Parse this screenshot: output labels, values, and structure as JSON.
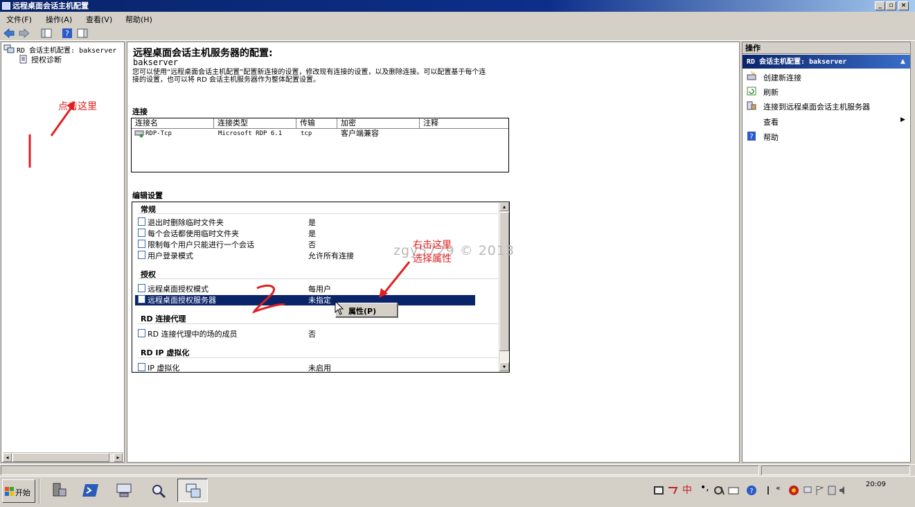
{
  "window": {
    "title": "远程桌面会话主机配置"
  },
  "menu": [
    "文件(F)",
    "操作(A)",
    "查看(V)",
    "帮助(H)"
  ],
  "tree": {
    "root": "RD 会话主机配置: bakserver",
    "child": "授权诊断"
  },
  "main": {
    "heading": "远程桌面会话主机服务器的配置:",
    "server": "bakserver",
    "description1": "您可以使用“远程桌面会话主机配置”配置新连接的设置，修改现有连接的设置，以及删除连接。可以配置基于每个连",
    "description2": "接的设置，也可以将 RD 会话主机服务器作为整体配置设置。",
    "connections_title": "连接",
    "columns": [
      "连接名",
      "连接类型",
      "传输",
      "加密",
      "注释"
    ],
    "connection": {
      "name": "RDP-Tcp",
      "type": "Microsoft RDP 6.1",
      "transport": "tcp",
      "encryption": "客户端兼容",
      "comment": ""
    },
    "edit_title": "编辑设置",
    "sections": {
      "general": "常规",
      "licensing": "授权",
      "broker": "RD 连接代理",
      "ipv": "RD IP 虚拟化"
    },
    "settings": {
      "s1": {
        "label": "退出时删除临时文件夹",
        "value": "是"
      },
      "s2": {
        "label": "每个会话都使用临时文件夹",
        "value": "是"
      },
      "s3": {
        "label": "限制每个用户只能进行一个会话",
        "value": "否"
      },
      "s4": {
        "label": "用户登录模式",
        "value": "允许所有连接"
      },
      "s5": {
        "label": "远程桌面授权模式",
        "value": "每用户"
      },
      "s6": {
        "label": "远程桌面授权服务器",
        "value": "未指定"
      },
      "s7": {
        "label": "RD 连接代理中的场的成员",
        "value": "否"
      },
      "s8": {
        "label": "IP 虚拟化",
        "value": "未启用"
      }
    },
    "context_menu": "属性(P)"
  },
  "actions": {
    "pane_title": "操作",
    "section": "RD 会话主机配置: bakserver",
    "items": [
      "创建新连接",
      "刷新",
      "连接到远程桌面会话主机服务器",
      "查看",
      "帮助"
    ]
  },
  "annotations": {
    "click_here": "点击这里",
    "right_click": "右击这里",
    "choose_props": "选择属性",
    "watermark": "zgy5729 © 2013"
  },
  "taskbar": {
    "start": "开始",
    "ime": "中",
    "time": "20:09"
  },
  "colors": {
    "title_blue": "#0a246a",
    "selection": "#0a246a",
    "annotation_red": "#e02020"
  }
}
